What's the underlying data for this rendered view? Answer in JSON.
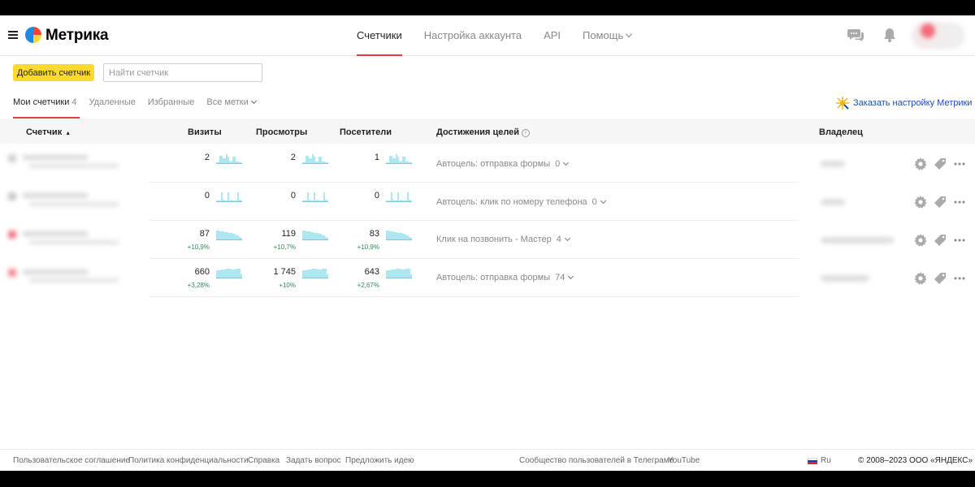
{
  "header": {
    "brand": "Метрика",
    "nav": [
      {
        "label": "Счетчики",
        "active": true
      },
      {
        "label": "Настройка аккаунта",
        "active": false
      },
      {
        "label": "API",
        "active": false
      },
      {
        "label": "Помощь",
        "active": false
      }
    ],
    "icons": [
      "menu-icon",
      "chat-icon",
      "bell-icon",
      "avatar"
    ]
  },
  "toolbar": {
    "add_button": "Добавить счетчик",
    "search_placeholder": "Найти счетчик"
  },
  "tabs": [
    {
      "label": "Мои счетчики",
      "count": "4",
      "active": true
    },
    {
      "label": "Удаленные",
      "active": false
    },
    {
      "label": "Избранные",
      "active": false
    },
    {
      "label": "Все метки",
      "active": false
    }
  ],
  "order_link": "Заказать настройку Метрики",
  "table": {
    "columns": {
      "counter": "Счетчик",
      "sort_arrow": "▲",
      "visits": "Визиты",
      "views": "Просмотры",
      "visitors": "Посетители",
      "goals": "Достижения целей",
      "info": "i",
      "owner": "Владелец"
    },
    "rows": [
      {
        "visits": "2",
        "visits_delta": "",
        "views": "2",
        "views_delta": "",
        "visitors": "1",
        "visitors_delta": "",
        "goal": "Автоцель: отправка формы",
        "goal_count": "0"
      },
      {
        "visits": "0",
        "visits_delta": "",
        "views": "0",
        "views_delta": "",
        "visitors": "0",
        "visitors_delta": "",
        "goal": "Автоцель: клик по номеру телефона",
        "goal_count": "0"
      },
      {
        "visits": "87",
        "visits_delta": "+10,9%",
        "views": "119",
        "views_delta": "+10,7%",
        "visitors": "83",
        "visitors_delta": "+10,9%",
        "goal": "Клик на позвонить - Мастер",
        "goal_count": "4"
      },
      {
        "visits": "660",
        "visits_delta": "+3,28%",
        "views": "1 745",
        "views_delta": "+10%",
        "visitors": "643",
        "visitors_delta": "+2,67%",
        "goal": "Автоцель: отправка формы",
        "goal_count": "74"
      }
    ]
  },
  "footer": {
    "links": [
      "Пользовательское соглашение",
      "Политика конфиденциальности",
      "Справка",
      "Задать вопрос",
      "Предложить идею"
    ],
    "community": "Сообщество пользователей в Телеграме",
    "youtube": "YouTube",
    "lang": "Ru",
    "copyright": "© 2008–2023 ООО «ЯНДЕКС»"
  },
  "colors": {
    "accent": "#e63946",
    "button": "#fcd92d",
    "link": "#1a4fb3",
    "positive": "#2e8b57",
    "sparkline": "#aee7f0"
  }
}
